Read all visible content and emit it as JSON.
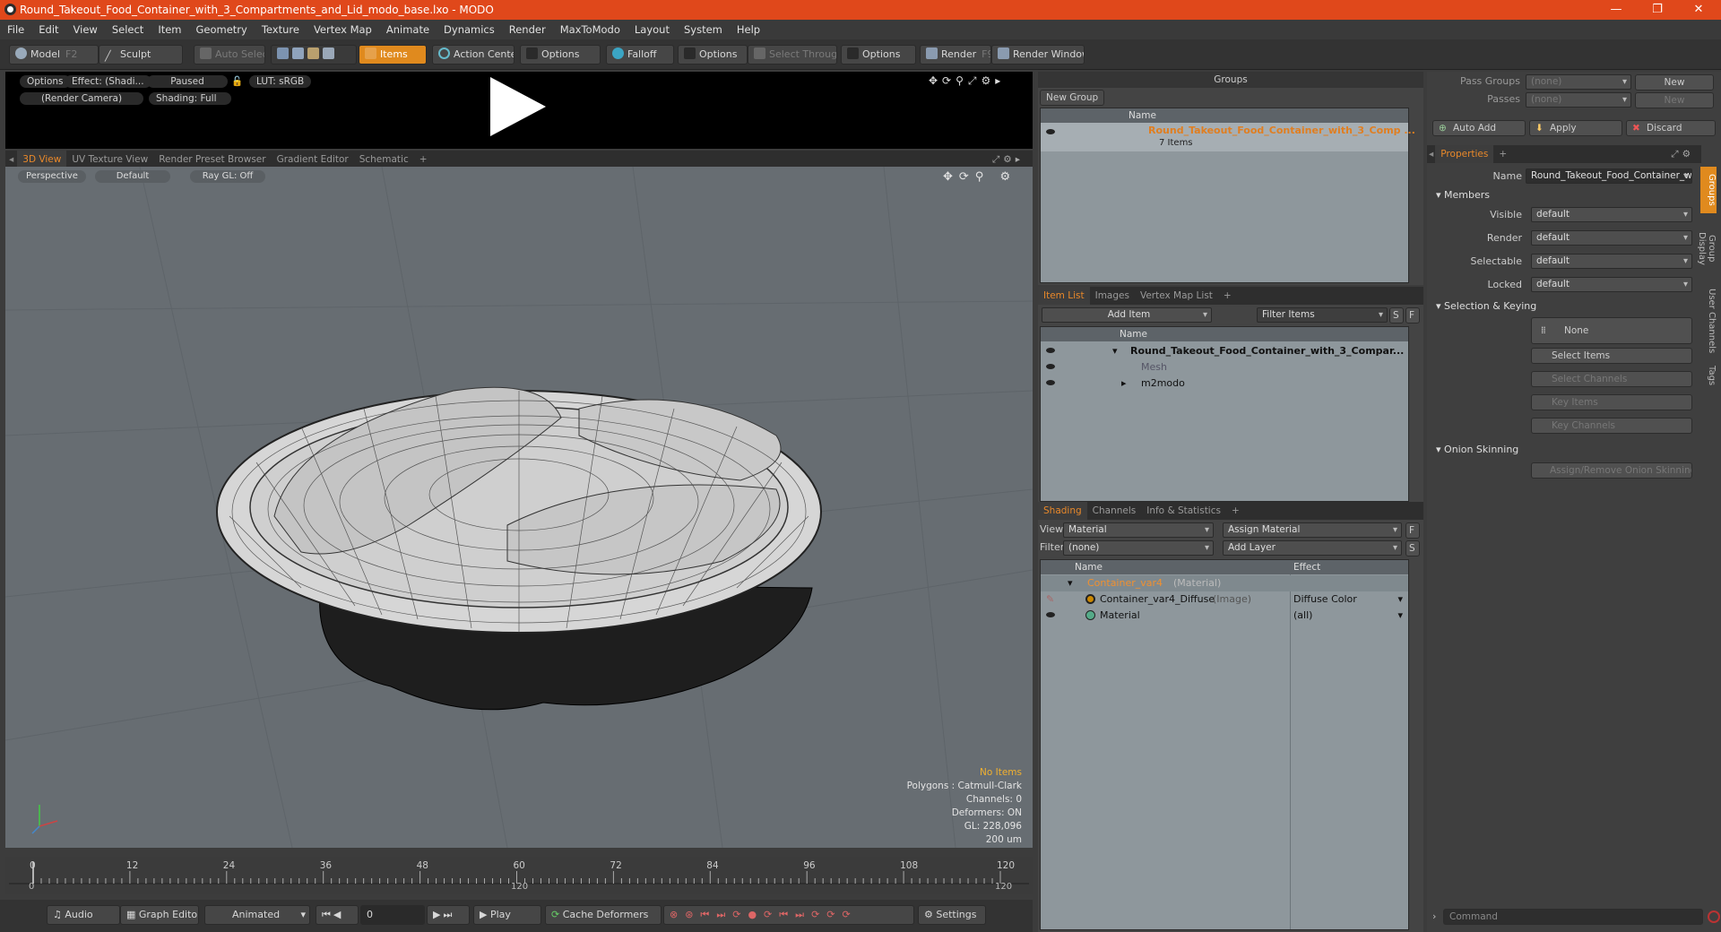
{
  "window": {
    "title": "Round_Takeout_Food_Container_with_3_Compartments_and_Lid_modo_base.lxo - MODO",
    "minimize": "—",
    "maximize": "❐",
    "close": "✕"
  },
  "menu": [
    "File",
    "Edit",
    "View",
    "Select",
    "Item",
    "Geometry",
    "Texture",
    "Vertex Map",
    "Animate",
    "Dynamics",
    "Render",
    "MaxToModo",
    "Layout",
    "System",
    "Help"
  ],
  "toolbar": {
    "model": "Model",
    "model_key": "F2",
    "sculpt": "Sculpt",
    "auto_select": "Auto Select",
    "items": "Items",
    "action_center": "Action Center",
    "options1": "Options",
    "falloff": "Falloff",
    "options2": "Options",
    "select_through": "Select Through",
    "options3": "Options",
    "render": "Render",
    "render_key": "F9",
    "render_window": "Render Window"
  },
  "preview": {
    "options": "Options",
    "effect": "Effect: (Shadi...",
    "paused": "Paused",
    "lut": "LUT: sRGB",
    "camera": "(Render Camera)",
    "shading": "Shading: Full"
  },
  "viewport_tabs": [
    "3D View",
    "UV Texture View",
    "Render Preset Browser",
    "Gradient Editor",
    "Schematic",
    "+"
  ],
  "viewport": {
    "perspective": "Perspective",
    "default": "Default",
    "raygl": "Ray GL: Off"
  },
  "viewport_info": {
    "no_items": "No Items",
    "polygons": "Polygons : Catmull-Clark",
    "channels": "Channels: 0",
    "deformers": "Deformers: ON",
    "gl": "GL: 228,096",
    "scale": "200 um"
  },
  "timeline": {
    "ticks": [
      "0",
      "12",
      "24",
      "36",
      "48",
      "60",
      "72",
      "84",
      "96",
      "108",
      "120"
    ],
    "sub_start": "0",
    "sub_mid": "120",
    "sub_end": "120"
  },
  "bottombar": {
    "audio": "Audio",
    "graph_editor": "Graph Editor",
    "animated": "Animated",
    "frame": "0",
    "play": "Play",
    "cache_deformers": "Cache Deformers",
    "settings": "Settings"
  },
  "groups": {
    "title": "Groups",
    "new_group": "New Group",
    "col_name": "Name",
    "item_name": "Round_Takeout_Food_Container_with_3_Comp ...",
    "item_count": "7 Items"
  },
  "item_list": {
    "tabs": [
      "Item List",
      "Images",
      "Vertex Map List",
      "+"
    ],
    "add_item": "Add Item",
    "filter": "Filter Items",
    "s": "S",
    "f": "F",
    "col_name": "Name",
    "rows": [
      "Round_Takeout_Food_Container_with_3_Compar...",
      "Mesh",
      "m2modo"
    ]
  },
  "shading": {
    "tabs": [
      "Shading",
      "Channels",
      "Info & Statistics",
      "+"
    ],
    "view_label": "View",
    "view_value": "Material",
    "assign": "Assign Material",
    "f": "F",
    "filter_label": "Filter",
    "filter_value": "(none)",
    "add_layer": "Add Layer",
    "s": "S",
    "col_name": "Name",
    "col_effect": "Effect",
    "rows": [
      {
        "name": "Container_var4",
        "type": "(Material)",
        "effect": ""
      },
      {
        "name": "Container_var4_Diffuse",
        "type": "(Image)",
        "effect": "Diffuse Color"
      },
      {
        "name": "Material",
        "type": "",
        "effect": "(all)"
      }
    ]
  },
  "right": {
    "pass_groups": "Pass Groups",
    "passes": "Passes",
    "none1": "(none)",
    "none2": "(none)",
    "new1": "New",
    "new2": "New",
    "auto_add": "Auto Add",
    "apply": "Apply",
    "discard": "Discard",
    "properties_tab": "Properties",
    "plus": "+",
    "name_label": "Name",
    "name_value": "Round_Takeout_Food_Container_w",
    "members": "Members",
    "visible_label": "Visible",
    "visible": "default",
    "render_label": "Render",
    "render": "default",
    "selectable_label": "Selectable",
    "selectable": "default",
    "locked_label": "Locked",
    "locked": "default",
    "selection_keying": "Selection & Keying",
    "none_btn": "None",
    "select_items": "Select Items",
    "select_channels": "Select Channels",
    "key_items": "Key Items",
    "key_channels": "Key Channels",
    "onion": "Onion Skinning",
    "assign_onion": "Assign/Remove Onion Skinning",
    "vtabs": [
      "Groups",
      "Group Display",
      "User Channels",
      "Tags"
    ],
    "command": "Command"
  }
}
